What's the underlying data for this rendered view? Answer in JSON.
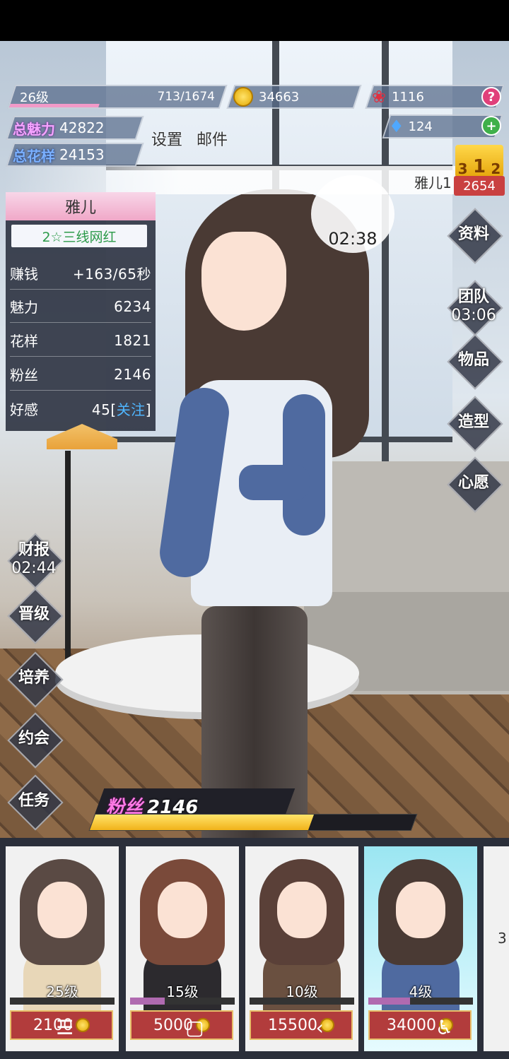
{
  "header": {
    "level": "26级",
    "exp": "713/1674",
    "exp_fraction": 0.426,
    "coins": "34663",
    "roses": "1116",
    "diamonds": "124",
    "help_icon": "?",
    "add_icon": "+"
  },
  "stats": {
    "charm_label": "总魅力",
    "charm_value": "42822",
    "style_label": "总花样",
    "style_value": "24153"
  },
  "menu": {
    "settings": "设置",
    "mail": "邮件"
  },
  "banner": {
    "name": "雅儿1"
  },
  "rank": {
    "podium": [
      "3",
      "1",
      "2"
    ],
    "score": "2654"
  },
  "bubble": {
    "timer": "02:38"
  },
  "character": {
    "name": "雅儿",
    "tier": "2☆三线网红",
    "rows": [
      {
        "label": "赚钱",
        "value": "+163/65秒"
      },
      {
        "label": "魅力",
        "value": "6234"
      },
      {
        "label": "花样",
        "value": "1821"
      },
      {
        "label": "粉丝",
        "value": "2146"
      }
    ],
    "favor_label": "好感",
    "favor_value": "45",
    "follow": "关注"
  },
  "right_buttons": {
    "profile": "资料",
    "team": "团队",
    "team_timer": "03:06",
    "items": "物品",
    "styling": "造型",
    "wish": "心愿"
  },
  "left_buttons": {
    "report": "财报",
    "report_timer": "02:44",
    "promote": "晋级",
    "train": "培养",
    "date": "约会",
    "tasks": "任务"
  },
  "fans": {
    "label": "粉丝",
    "value": "2146",
    "fraction": 0.68
  },
  "cards": [
    {
      "level": "25级",
      "price": "2100",
      "progress": 0.0,
      "hair": "#5a4a44",
      "outfit": "#e8d7b8",
      "selected": false
    },
    {
      "level": "15级",
      "price": "5000",
      "progress": 0.33,
      "hair": "#7a4a3a",
      "outfit": "#2c2a2e",
      "selected": false
    },
    {
      "level": "10级",
      "price": "15500",
      "progress": 0.0,
      "hair": "#5a4038",
      "outfit": "#6a5040",
      "selected": false
    },
    {
      "level": "4级",
      "price": "34000",
      "progress": 0.4,
      "hair": "#4a3a34",
      "outfit": "#4f6aa0",
      "selected": true
    }
  ],
  "card_peek": "3",
  "nav": {
    "menu_icon": "☰",
    "home_icon": "▢",
    "back_icon": "‹",
    "accessibility_icon": "♿"
  },
  "colors": {
    "exp_fill": "#f29ac8",
    "fans_fill": "#f1b21a",
    "price_bg": "#b23c3c",
    "tier_text": "#2c9a49",
    "follow_text": "#4fb6ff"
  }
}
